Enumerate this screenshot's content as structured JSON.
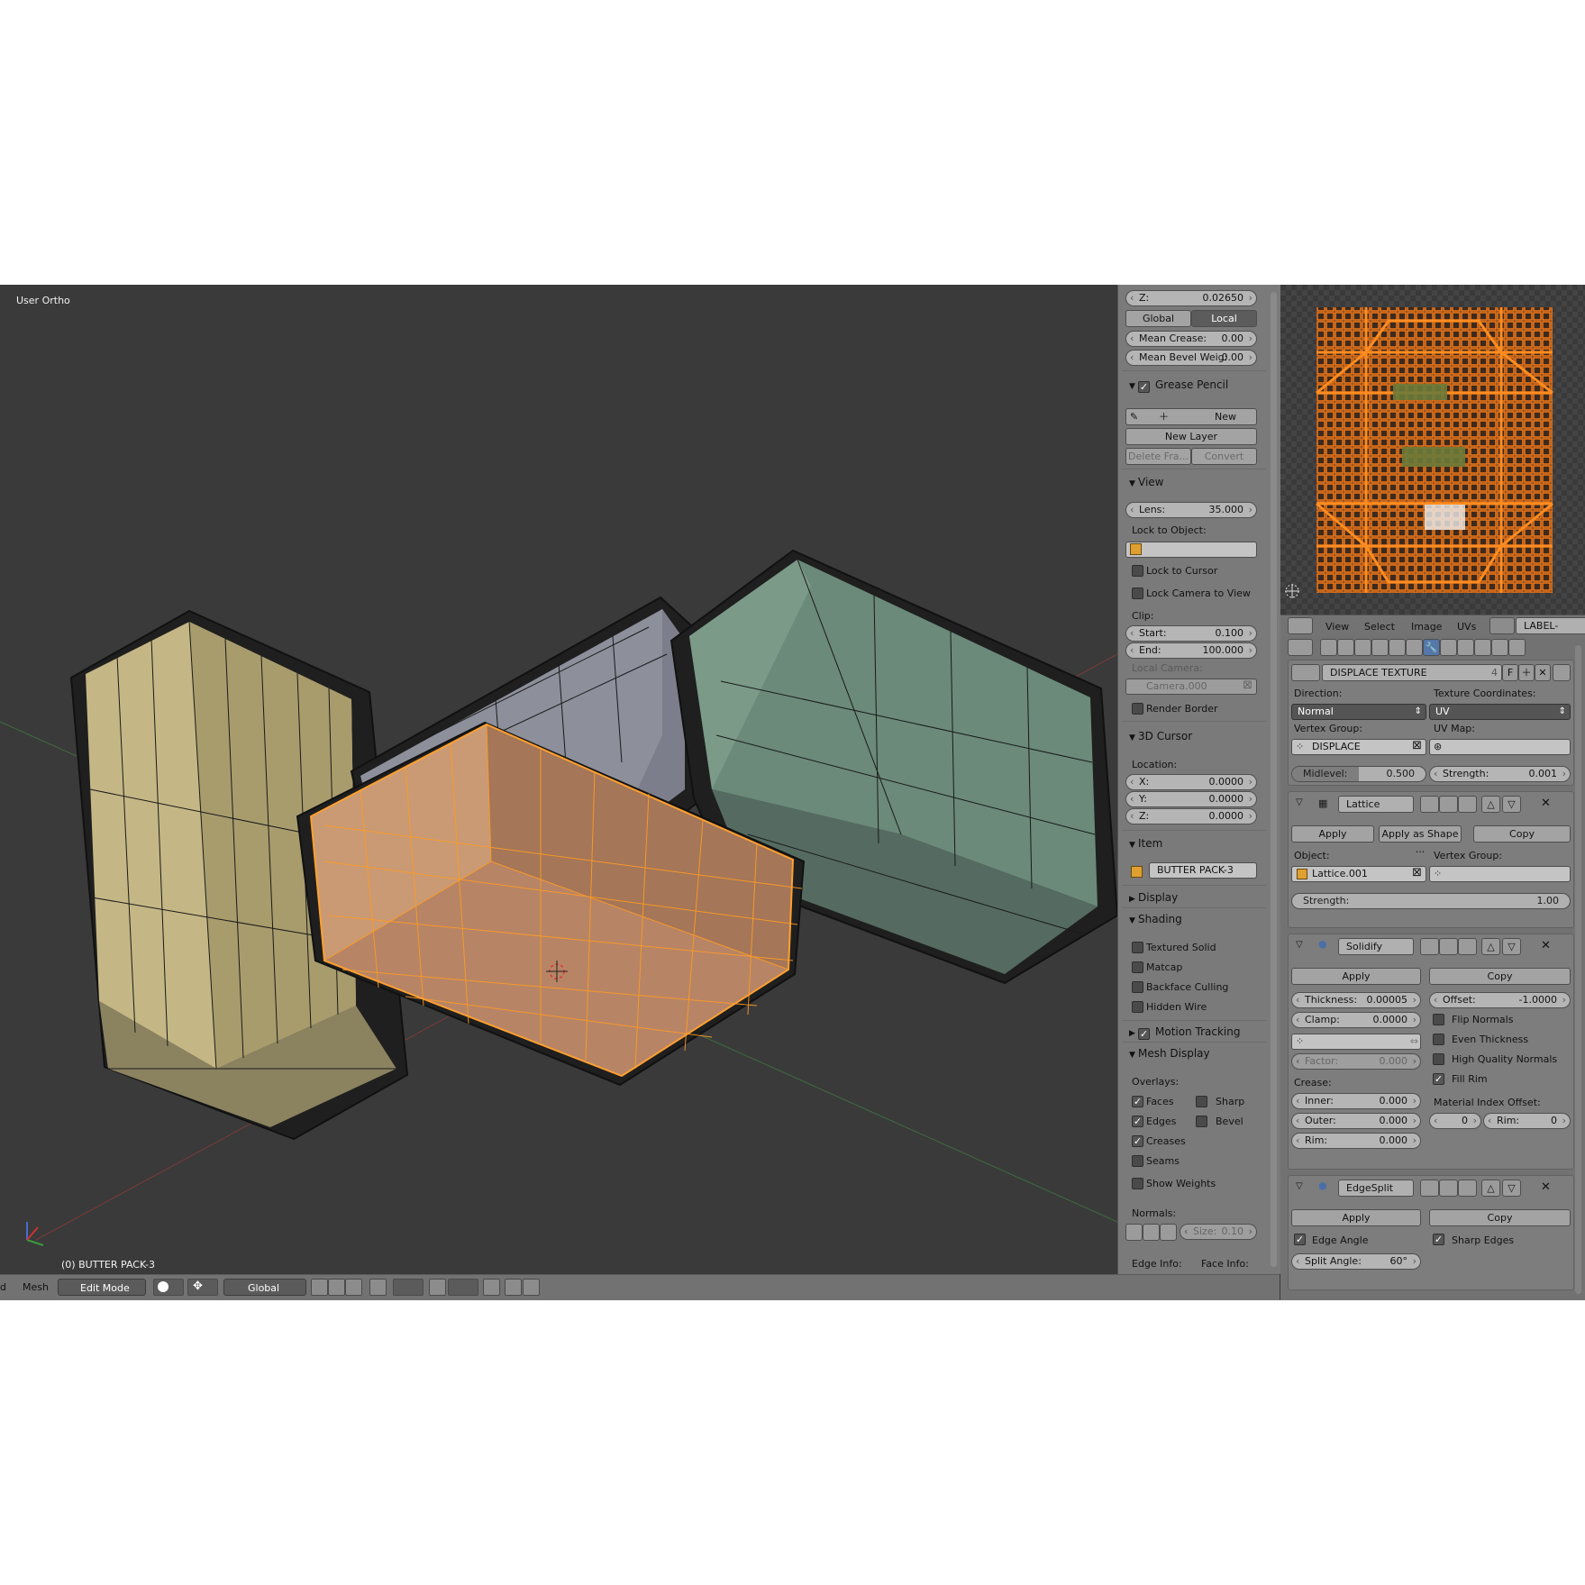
{
  "viewport": {
    "view_name": "User Ortho",
    "object_info": "(0) BUTTER PACK-3"
  },
  "header3d": {
    "left_clip": "d",
    "mesh_menu": "Mesh",
    "mode": "Edit Mode",
    "orientation": "Global"
  },
  "npanel": {
    "z_label": "Z:",
    "z_value": "0.02650",
    "global_btn": "Global",
    "local_btn": "Local",
    "mean_crease_label": "Mean Crease:",
    "mean_crease_value": "0.00",
    "mean_bevel_label": "Mean Bevel Weig:",
    "mean_bevel_value": "0.00",
    "grease_pencil": {
      "title": "Grease Pencil",
      "new": "New",
      "new_layer": "New Layer",
      "delete_frame": "Delete Fra...",
      "convert": "Convert"
    },
    "view": {
      "title": "View",
      "lens_label": "Lens:",
      "lens_value": "35.000",
      "lock_to_object": "Lock to Object:",
      "lock_to_cursor": "Lock to Cursor",
      "lock_camera": "Lock Camera to View",
      "clip": "Clip:",
      "start_label": "Start:",
      "start_value": "0.100",
      "end_label": "End:",
      "end_value": "100.000",
      "local_camera": "Local Camera:",
      "camera": "Camera.000",
      "render_border": "Render Border"
    },
    "cursor": {
      "title": "3D Cursor",
      "location": "Location:",
      "x_label": "X:",
      "x_value": "0.0000",
      "y_label": "Y:",
      "y_value": "0.0000",
      "z_label": "Z:",
      "z_value": "0.0000"
    },
    "item": {
      "title": "Item",
      "name": "BUTTER PACK-3"
    },
    "display": {
      "title": "Display"
    },
    "shading": {
      "title": "Shading",
      "textured_solid": "Textured Solid",
      "matcap": "Matcap",
      "backface_culling": "Backface Culling",
      "hidden_wire": "Hidden Wire"
    },
    "motion_tracking": {
      "title": "Motion Tracking"
    },
    "mesh_display": {
      "title": "Mesh Display",
      "overlays": "Overlays:",
      "faces": "Faces",
      "sharp": "Sharp",
      "edges": "Edges",
      "bevel": "Bevel",
      "creases": "Creases",
      "seams": "Seams",
      "show_weights": "Show Weights",
      "normals": "Normals:",
      "size_label": "Size:",
      "size_value": "0.10",
      "edge_info": "Edge Info:",
      "face_info": "Face Info:"
    }
  },
  "uv_header": {
    "view": "View",
    "select": "Select",
    "image": "Image",
    "uvs": "UVs",
    "image_name": "LABEL-ALPHA"
  },
  "props": {
    "displace": {
      "name": "DISPLACE TEXTURE",
      "users": "4",
      "fake": "F",
      "direction_label": "Direction:",
      "direction_value": "Normal",
      "texcoords_label": "Texture Coordinates:",
      "texcoords_value": "UV",
      "vgroup_label": "Vertex Group:",
      "vgroup_value": "DISPLACE",
      "uvmap_label": "UV Map:",
      "midlevel_label": "Midlevel:",
      "midlevel_value": "0.500",
      "midlevel_fraction": 0.5,
      "strength_label": "Strength:",
      "strength_value": "0.001"
    },
    "lattice": {
      "name": "Lattice",
      "apply": "Apply",
      "apply_shape": "Apply as Shape ...",
      "copy": "Copy",
      "object_label": "Object:",
      "object_value": "Lattice.001",
      "vgroup_label": "Vertex Group:",
      "strength_label": "Strength:",
      "strength_value": "1.00"
    },
    "solidify": {
      "name": "Solidify",
      "apply": "Apply",
      "copy": "Copy",
      "thickness_label": "Thickness:",
      "thickness_value": "0.00005",
      "offset_label": "Offset:",
      "offset_value": "-1.0000",
      "clamp_label": "Clamp:",
      "clamp_value": "0.0000",
      "flip_normals": "Flip Normals",
      "even_thickness": "Even Thickness",
      "hq_normals": "High Quality Normals",
      "fill_rim": "Fill Rim",
      "factor_label": "Factor:",
      "factor_value": "0.000",
      "crease_label": "Crease:",
      "mat_offset_label": "Material Index Offset:",
      "inner_label": "Inner:",
      "inner_value": "0.000",
      "outer_label": "Outer:",
      "outer_value": "0.000",
      "rim_label": "Rim:",
      "rim_value": "0.000",
      "mat_offset_value": "0",
      "mat_rim_label": "Rim:",
      "mat_rim_value": "0"
    },
    "edgesplit": {
      "name": "EdgeSplit",
      "apply": "Apply",
      "copy": "Copy",
      "edge_angle": "Edge Angle",
      "sharp_edges": "Sharp Edges",
      "split_angle_label": "Split Angle:",
      "split_angle_value": "60°"
    }
  },
  "colors": {
    "viewport_bg": "#3a3a3a",
    "panel_bg": "#7a7a7a",
    "selection": "#ff8a1a",
    "box_yellow": "#b9ad7c",
    "box_teal": "#5f7a6c",
    "box_grey": "#8c8e9a",
    "box_orange": "#c48b66"
  }
}
